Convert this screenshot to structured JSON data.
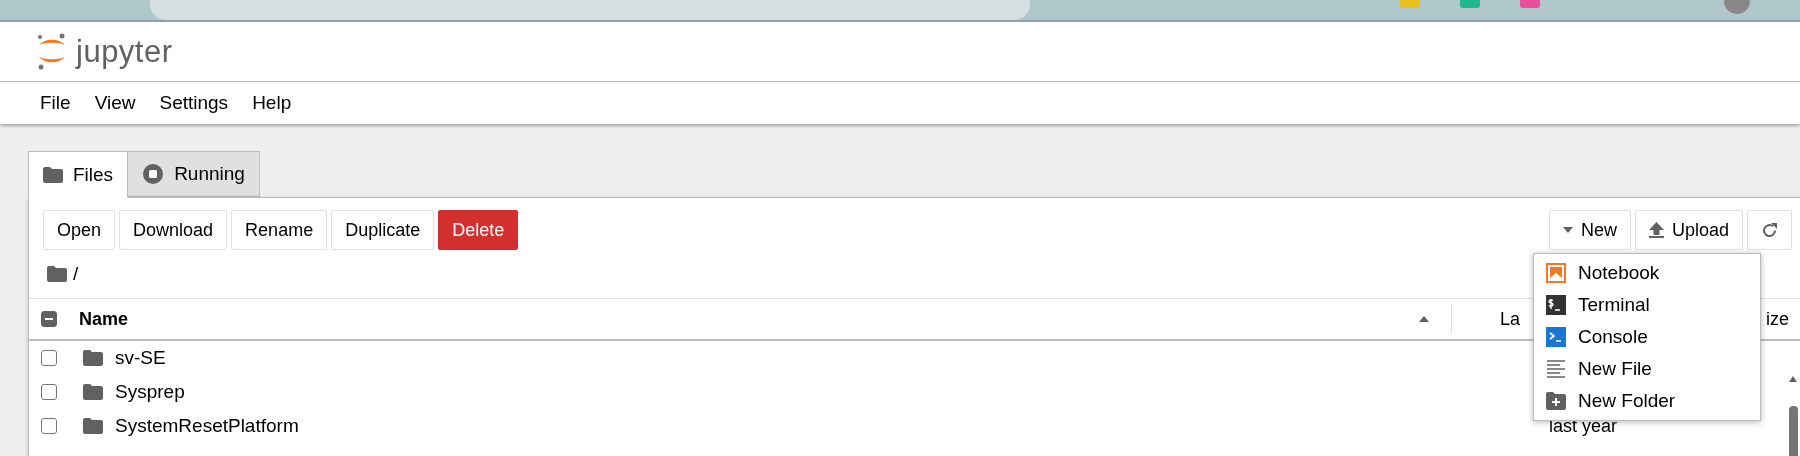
{
  "logo": {
    "text": "jupyter"
  },
  "menu_bar": [
    {
      "label": "File"
    },
    {
      "label": "View"
    },
    {
      "label": "Settings"
    },
    {
      "label": "Help"
    }
  ],
  "tabs": [
    {
      "label": "Files",
      "kind": "folder",
      "selected": true
    },
    {
      "label": "Running",
      "kind": "running",
      "selected": false
    }
  ],
  "toolbar": {
    "left": [
      {
        "label": "Open",
        "kind": "default"
      },
      {
        "label": "Download",
        "kind": "default"
      },
      {
        "label": "Rename",
        "kind": "default"
      },
      {
        "label": "Duplicate",
        "kind": "default"
      },
      {
        "label": "Delete",
        "kind": "danger"
      }
    ],
    "right": [
      {
        "label": "New",
        "kind": "dropdown"
      },
      {
        "label": "Upload",
        "kind": "upload"
      },
      {
        "kind": "refresh"
      }
    ]
  },
  "breadcrumb": "/",
  "listing": {
    "select_all_indeterminate": true,
    "columns": [
      {
        "label": "Name",
        "sorted": true
      },
      {
        "label": "La"
      },
      {
        "label": "ize"
      }
    ],
    "rows": [
      {
        "name": "sv-SE",
        "checked": false
      },
      {
        "name": "Sysprep",
        "checked": false
      },
      {
        "name": "SystemResetPlatform",
        "checked": false,
        "modified": "last year"
      }
    ]
  },
  "new_menu": {
    "open": true,
    "items": [
      {
        "label": "Notebook",
        "kind": "notebook"
      },
      {
        "label": "Terminal",
        "kind": "terminal"
      },
      {
        "label": "Console",
        "kind": "console"
      },
      {
        "label": "New File",
        "kind": "file"
      },
      {
        "label": "New Folder",
        "kind": "folder"
      }
    ]
  }
}
